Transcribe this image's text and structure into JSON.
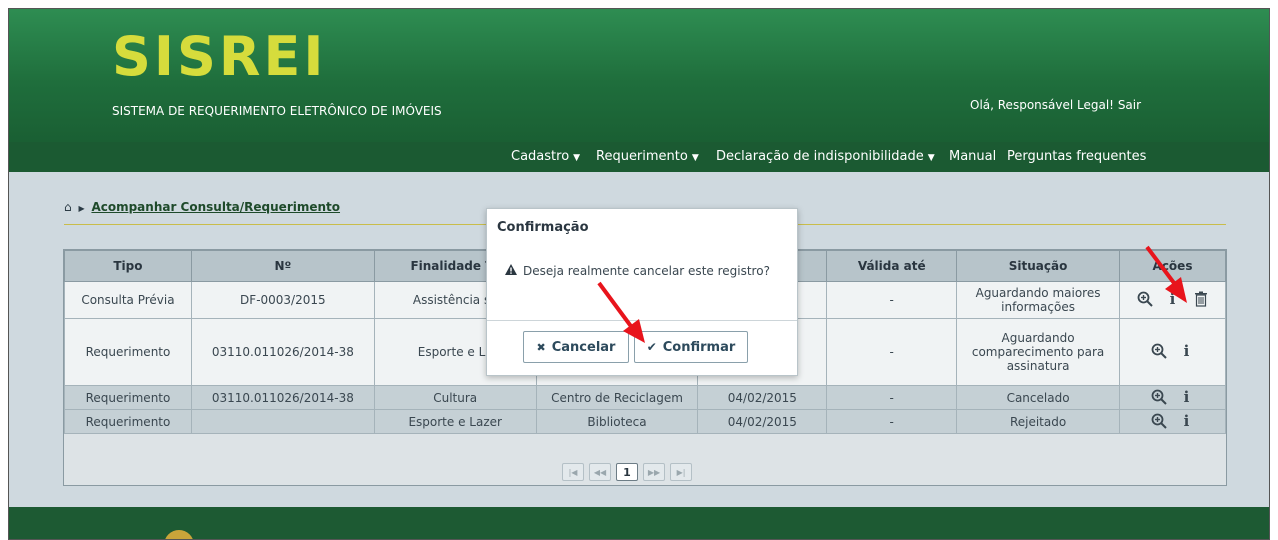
{
  "header": {
    "logo": "SISREI",
    "subtitle": "SISTEMA DE REQUERIMENTO ELETRÔNICO DE IMÓVEIS",
    "greeting": "Olá, Responsável Legal!",
    "logout": "Sair"
  },
  "nav": {
    "items": [
      {
        "label": "Cadastro",
        "dropdown": true
      },
      {
        "label": "Requerimento",
        "dropdown": true
      },
      {
        "label": "Declaração de indisponibilidade",
        "dropdown": true
      },
      {
        "label": "Manual",
        "dropdown": false
      },
      {
        "label": "Perguntas frequentes",
        "dropdown": false
      }
    ]
  },
  "breadcrumb": {
    "home_icon": "home-icon",
    "current": "Acompanhar Consulta/Requerimento"
  },
  "table": {
    "headers": [
      "Tipo",
      "Nº",
      "Finalidade Te",
      "",
      "",
      "Válida até",
      "Situação",
      "Ações"
    ],
    "rows": [
      {
        "tipo": "Consulta Prévia",
        "numero": "DF-0003/2015",
        "finalidade": "Assistência so",
        "col4": "",
        "col5": "",
        "valida": "-",
        "situacao": "Aguardando maiores informações",
        "actions": [
          "zoom-icon",
          "info-icon",
          "trash-icon"
        ]
      },
      {
        "tipo": "Requerimento",
        "numero": "03110.011026/2014-38",
        "finalidade": "Esporte e La",
        "col4": "",
        "col5": "",
        "valida": "-",
        "situacao": "Aguardando comparecimento para assinatura",
        "actions": [
          "zoom-icon",
          "info-icon"
        ]
      },
      {
        "tipo": "Requerimento",
        "numero": "03110.011026/2014-38",
        "finalidade": "Cultura",
        "col4": "Centro de Reciclagem",
        "col5": "04/02/2015",
        "valida": "-",
        "situacao": "Cancelado",
        "actions": [
          "zoom-icon",
          "info-icon"
        ]
      },
      {
        "tipo": "Requerimento",
        "numero": "",
        "finalidade": "Esporte e Lazer",
        "col4": "Biblioteca",
        "col5": "04/02/2015",
        "valida": "-",
        "situacao": "Rejeitado",
        "actions": [
          "zoom-icon",
          "info-icon"
        ]
      }
    ]
  },
  "pager": {
    "first": "|◀",
    "prev": "◀◀",
    "current": "1",
    "next": "▶▶",
    "last": "▶|"
  },
  "modal": {
    "title": "Confirmação",
    "message": "Deseja realmente cancelar este registro?",
    "cancel_label": "Cancelar",
    "confirm_label": "Confirmar"
  },
  "colors": {
    "header_green": "#2e8d52",
    "nav_green": "#1b5a32",
    "logo_yellow": "#d6dc3c",
    "arrow_red": "#e8141c"
  }
}
